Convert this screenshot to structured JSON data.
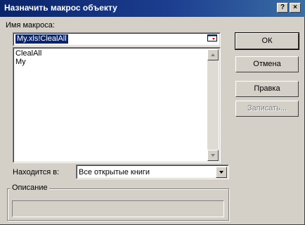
{
  "dialog": {
    "title": "Назначить макрос объекту",
    "help_button": "?",
    "close_button": "×"
  },
  "macro_name": {
    "label": "Имя макроса:",
    "value": "My.xls!ClealAll"
  },
  "macro_list": {
    "items": [
      "ClealAll",
      "My"
    ]
  },
  "buttons": {
    "ok": "ОК",
    "cancel": "Отмена",
    "edit": "Правка",
    "record": "Записать..."
  },
  "location": {
    "label": "Находится в:",
    "value": "Все открытые книги"
  },
  "description": {
    "label": "Описание",
    "text": ""
  },
  "colors": {
    "titlebar": "#0a246a",
    "face": "#d4d0c8",
    "selection": "#0a246a"
  }
}
